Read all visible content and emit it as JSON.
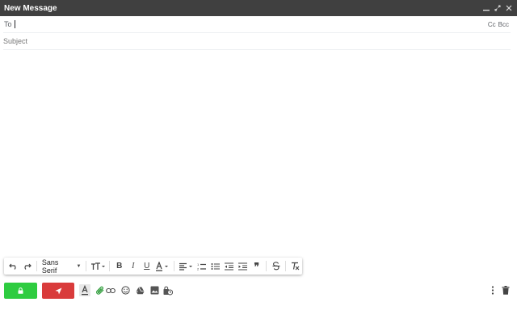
{
  "window": {
    "title": "New Message",
    "controls": [
      "minimize-icon",
      "expand-icon",
      "close-icon"
    ]
  },
  "recipients": {
    "to_label": "To",
    "to_value": "",
    "cc_label": "Cc",
    "bcc_label": "Bcc"
  },
  "subject": {
    "placeholder": "Subject",
    "value": ""
  },
  "formatting": {
    "font_family": "Sans Serif",
    "buttons": [
      "undo-icon",
      "redo-icon",
      "font-size-icon",
      "bold-icon",
      "italic-icon",
      "underline-icon",
      "text-color-icon",
      "align-icon",
      "numbered-list-icon",
      "bulleted-list-icon",
      "indent-less-icon",
      "indent-more-icon",
      "quote-icon",
      "strikethrough-icon",
      "remove-formatting-icon"
    ]
  },
  "bottom_bar": {
    "tools": [
      "formatting-options-icon",
      "attach-file-icon",
      "insert-link-icon",
      "emoji-icon",
      "google-drive-icon",
      "insert-photo-icon",
      "confidential-mode-icon"
    ],
    "right_tools": [
      "more-options-icon",
      "discard-draft-icon"
    ],
    "colors": {
      "lock_button": "#2ecc40",
      "send_button": "#d93b3b",
      "attach_icon": "#2e9c3a"
    }
  }
}
